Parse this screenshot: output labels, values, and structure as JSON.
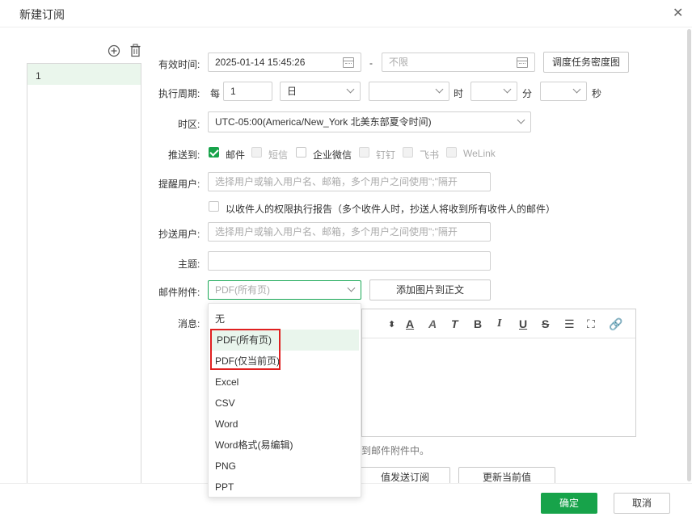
{
  "dialog": {
    "title": "新建订阅",
    "close_icon": "close-icon"
  },
  "list": {
    "items": [
      "1"
    ]
  },
  "form": {
    "valid_time_label": "有效时间:",
    "start_time": "2025-01-14 15:45:26",
    "dash": "-",
    "end_time_placeholder": "不限",
    "density_button": "调度任务密度图",
    "cycle_label": "执行周期:",
    "every": "每",
    "every_value": "1",
    "unit": "日",
    "hour": "时",
    "minute": "分",
    "second": "秒",
    "timezone_label": "时区:",
    "timezone": "UTC-05:00(America/New_York 北美东部夏令时间)",
    "push_label": "推送到:",
    "push_targets": [
      {
        "label": "邮件",
        "checked": true,
        "disabled": false
      },
      {
        "label": "短信",
        "checked": false,
        "disabled": true
      },
      {
        "label": "企业微信",
        "checked": false,
        "disabled": false
      },
      {
        "label": "钉钉",
        "checked": false,
        "disabled": true
      },
      {
        "label": "飞书",
        "checked": false,
        "disabled": true
      },
      {
        "label": "WeLink",
        "checked": false,
        "disabled": true
      }
    ],
    "remind_label": "提醒用户:",
    "remind_placeholder": "选择用户或输入用户名、邮箱，多个用户之间使用\";\"隔开",
    "permission_text": "以收件人的权限执行报告（多个收件人时，抄送人将收到所有收件人的邮件）",
    "cc_label": "抄送用户:",
    "cc_placeholder": "选择用户或输入用户名、邮箱，多个用户之间使用\";\"隔开",
    "subject_label": "主题:",
    "subject_value": "",
    "attach_label": "邮件附件:",
    "attach_value": "PDF(所有页)",
    "add_image_button": "添加图片到正文",
    "message_label": "消息:",
    "attach_hint": "到邮件附件中。",
    "send_sub_button": "值发送订阅",
    "update_value_button": "更新当前值"
  },
  "dropdown": {
    "options": [
      "无",
      "PDF(所有页)",
      "PDF(仅当前页)",
      "Excel",
      "CSV",
      "Word",
      "Word格式(易编辑)",
      "PNG",
      "PPT"
    ],
    "selected": "PDF(所有页)"
  },
  "footer": {
    "ok": "确定",
    "cancel": "取消"
  },
  "colors": {
    "accent": "#17a34a",
    "highlight": "#e02020",
    "selected_bg": "#e9f5ec"
  }
}
